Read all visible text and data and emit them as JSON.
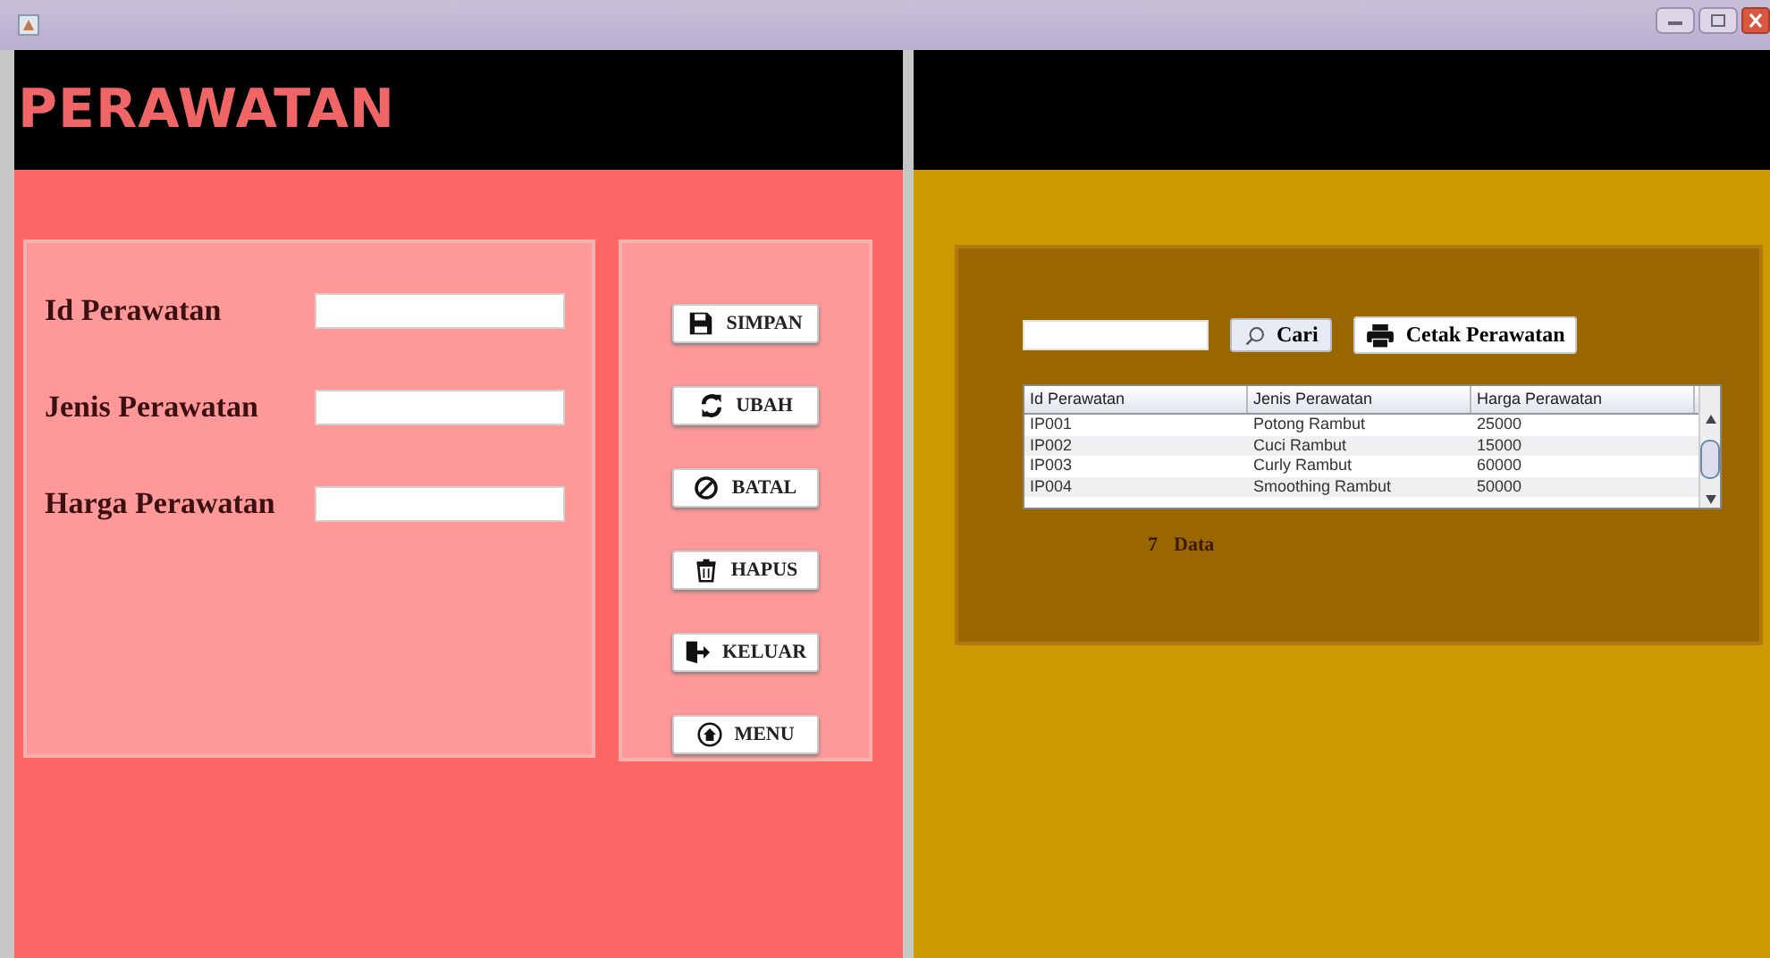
{
  "title": "PERAWATAN",
  "form": {
    "fields": [
      {
        "label": "Id Perawatan"
      },
      {
        "label": "Jenis Perawatan"
      },
      {
        "label": "Harga Perawatan"
      }
    ]
  },
  "buttons": [
    {
      "label": "SIMPAN",
      "kind": "save"
    },
    {
      "label": "UBAH",
      "kind": "refresh"
    },
    {
      "label": "BATAL",
      "kind": "cancel"
    },
    {
      "label": "HAPUS",
      "kind": "delete"
    },
    {
      "label": "KELUAR",
      "kind": "exit"
    },
    {
      "label": "MENU",
      "kind": "home"
    }
  ],
  "search": {
    "button": "Cari",
    "print_button": "Cetak Perawatan"
  },
  "table": {
    "columns": [
      "Id Perawatan",
      "Jenis Perawatan",
      "Harga Perawatan"
    ],
    "rows": [
      [
        "IP001",
        "Potong Rambut",
        "25000"
      ],
      [
        "IP002",
        "Cuci Rambut",
        "15000"
      ],
      [
        "IP003",
        "Curly Rambut",
        "60000"
      ],
      [
        "IP004",
        "Smoothing Rambut",
        "50000"
      ]
    ]
  },
  "count": {
    "value": "7",
    "label": "Data"
  }
}
